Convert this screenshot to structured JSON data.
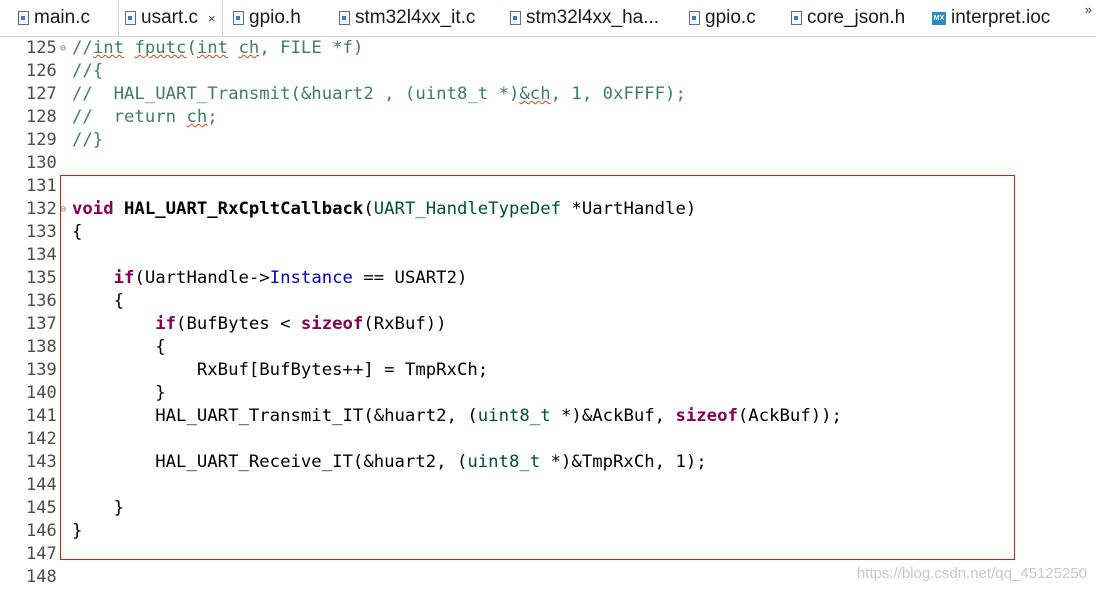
{
  "tabs": [
    {
      "label": "main.c",
      "icon": "c-file-icon"
    },
    {
      "label": "usart.c",
      "icon": "c-file-icon",
      "active": true
    },
    {
      "label": "gpio.h",
      "icon": "h-file-icon"
    },
    {
      "label": "stm32l4xx_it.c",
      "icon": "c-file-icon"
    },
    {
      "label": "stm32l4xx_ha...",
      "icon": "c-file-icon"
    },
    {
      "label": "gpio.c",
      "icon": "c-file-icon"
    },
    {
      "label": "core_json.h",
      "icon": "h-file-icon"
    },
    {
      "label": "interpret.ioc",
      "icon": "mx-file-icon"
    }
  ],
  "tab_close": "×",
  "tab_overflow": "»",
  "mx_icon_text": "MX",
  "fold_glyph": "⊖",
  "lines": [
    {
      "num": "125"
    },
    {
      "num": "126"
    },
    {
      "num": "127"
    },
    {
      "num": "128"
    },
    {
      "num": "129"
    },
    {
      "num": "130"
    },
    {
      "num": "131"
    },
    {
      "num": "132"
    },
    {
      "num": "133"
    },
    {
      "num": "134"
    },
    {
      "num": "135"
    },
    {
      "num": "136"
    },
    {
      "num": "137"
    },
    {
      "num": "138"
    },
    {
      "num": "139"
    },
    {
      "num": "140"
    },
    {
      "num": "141"
    },
    {
      "num": "142"
    },
    {
      "num": "143"
    },
    {
      "num": "144"
    },
    {
      "num": "145"
    },
    {
      "num": "146"
    },
    {
      "num": "147"
    },
    {
      "num": "148"
    }
  ],
  "code": {
    "l125": {
      "a": "//",
      "b": "int",
      "c": " ",
      "d": "fputc",
      "e": "(",
      "f": "int",
      "g": " ",
      "h": "ch",
      "i": ", FILE *f)"
    },
    "l126": "//{",
    "l127": {
      "a": "//  HAL_UART_Transmit(&huart2 , (uint8_t *)",
      "b": "&ch",
      "c": ", 1, 0xFFFF);"
    },
    "l128": {
      "a": "//  return ",
      "b": "ch",
      "c": ";"
    },
    "l129": "//}",
    "l132": {
      "kw": "void",
      "sp": " ",
      "fn": "HAL_UART_RxCpltCallback",
      "p1": "(",
      "ty": "UART_HandleTypeDef",
      "rest": " *UartHandle)"
    },
    "l133": "{",
    "l135": {
      "ind": "    ",
      "kw": "if",
      "a": "(UartHandle->",
      "fld": "Instance",
      "b": " == USART2)"
    },
    "l136": "    {",
    "l137": {
      "ind": "        ",
      "kw": "if",
      "a": "(BufBytes < ",
      "kw2": "sizeof",
      "b": "(RxBuf))"
    },
    "l138": "        {",
    "l139": "            RxBuf[BufBytes++] = TmpRxCh;",
    "l140": "        }",
    "l141": {
      "a": "        HAL_UART_Transmit_IT(&huart2, (",
      "ty": "uint8_t",
      "b": " *)&AckBuf, ",
      "kw": "sizeof",
      "c": "(AckBuf));"
    },
    "l143": {
      "a": "        HAL_UART_Receive_IT(&huart2, (",
      "ty": "uint8_t",
      "b": " *)&TmpRxCh, 1);"
    },
    "l145": "    }",
    "l146": "}"
  },
  "watermark": "https://blog.csdn.net/qq_45125250",
  "colors": {
    "comment": "#3f7f5f",
    "keyword": "#7f0055",
    "type": "#005032",
    "field": "#0000c0",
    "highlight_border": "#c81e1e"
  }
}
